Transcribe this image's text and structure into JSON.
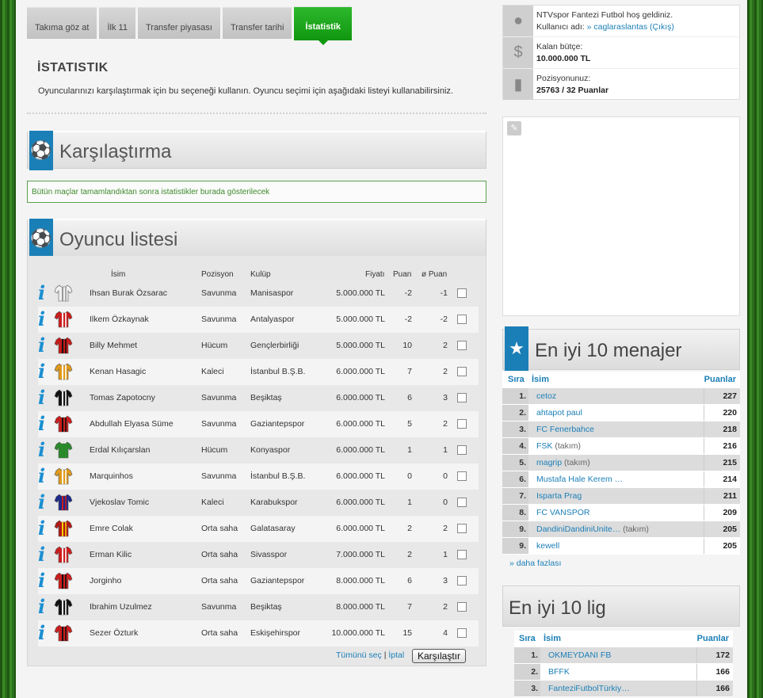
{
  "tabs": [
    "Takıma göz at",
    "İlk 11",
    "Transfer piyasası",
    "Transfer tarihi",
    "İstatistik"
  ],
  "section": {
    "title": "İSTATISTIK",
    "description": "Oyuncularınızı karşılaştırmak için bu seçeneği kullanın. Oyuncu seçimi için aşağıdaki listeyi kullanabilirsiniz."
  },
  "comparison": {
    "title": "Karşılaştırma",
    "notice": "Bütün maçlar tamamlandıktan sonra istatistikler burada gösterilecek"
  },
  "player_list": {
    "title": "Oyuncu listesi",
    "headers": {
      "name": "İsim",
      "position": "Pozisyon",
      "club": "Kulüp",
      "price": "Fiyatı",
      "points": "Puan",
      "avg": "ø Puan"
    },
    "players": [
      {
        "name": "Ihsan Burak Özsarac",
        "position": "Savunma",
        "club": "Manisaspor",
        "price": "5.000.000 TL",
        "points": "-2",
        "avg": "-1",
        "shirt": [
          "#f0f0f0",
          "#999999"
        ]
      },
      {
        "name": "Ilkem Özkaynak",
        "position": "Savunma",
        "club": "Antalyaspor",
        "price": "5.000.000 TL",
        "points": "-2",
        "avg": "-2",
        "shirt": [
          "#cc1c1c",
          "#ffffff"
        ]
      },
      {
        "name": "Billy Mehmet",
        "position": "Hücum",
        "club": "Gençlerbirliği",
        "price": "5.000.000 TL",
        "points": "10",
        "avg": "2",
        "shirt": [
          "#c81818",
          "#111111"
        ]
      },
      {
        "name": "Kenan Hasagic",
        "position": "Kaleci",
        "club": "İstanbul B.Ş.B.",
        "price": "6.000.000 TL",
        "points": "7",
        "avg": "2",
        "shirt": [
          "#e09a1a",
          "#ffffff"
        ]
      },
      {
        "name": "Tomas Zapotocny",
        "position": "Savunma",
        "club": "Beşiktaş",
        "price": "6.000.000 TL",
        "points": "6",
        "avg": "3",
        "shirt": [
          "#111111",
          "#ffffff"
        ]
      },
      {
        "name": "Abdullah Elyasa Süme",
        "position": "Savunma",
        "club": "Gaziantepspor",
        "price": "6.000.000 TL",
        "points": "5",
        "avg": "2",
        "shirt": [
          "#cc1c1c",
          "#111111"
        ]
      },
      {
        "name": "Erdal Kılıçarslan",
        "position": "Hücum",
        "club": "Konyaspor",
        "price": "6.000.000 TL",
        "points": "1",
        "avg": "1",
        "shirt": [
          "#2a8a2a",
          "#2a8a2a"
        ]
      },
      {
        "name": "Marquinhos",
        "position": "Savunma",
        "club": "İstanbul B.Ş.B.",
        "price": "6.000.000 TL",
        "points": "0",
        "avg": "0",
        "shirt": [
          "#e09a1a",
          "#ffffff"
        ]
      },
      {
        "name": "Vjekoslav Tomic",
        "position": "Kaleci",
        "club": "Karabukspor",
        "price": "6.000.000 TL",
        "points": "1",
        "avg": "0",
        "shirt": [
          "#1c2a8a",
          "#cc1c1c"
        ]
      },
      {
        "name": "Emre Colak",
        "position": "Orta saha",
        "club": "Galatasaray",
        "price": "6.000.000 TL",
        "points": "2",
        "avg": "2",
        "shirt": [
          "#b01818",
          "#f5d000"
        ]
      },
      {
        "name": "Erman Kilic",
        "position": "Orta saha",
        "club": "Sivasspor",
        "price": "7.000.000 TL",
        "points": "2",
        "avg": "1",
        "shirt": [
          "#cc1c1c",
          "#ffffff"
        ]
      },
      {
        "name": "Jorginho",
        "position": "Orta saha",
        "club": "Gaziantepspor",
        "price": "8.000.000 TL",
        "points": "6",
        "avg": "3",
        "shirt": [
          "#cc1c1c",
          "#111111"
        ]
      },
      {
        "name": "Ibrahim Uzulmez",
        "position": "Savunma",
        "club": "Beşiktaş",
        "price": "8.000.000 TL",
        "points": "7",
        "avg": "2",
        "shirt": [
          "#111111",
          "#ffffff"
        ]
      },
      {
        "name": "Sezer Özturk",
        "position": "Orta saha",
        "club": "Eskişehirspor",
        "price": "10.000.000 TL",
        "points": "15",
        "avg": "4",
        "shirt": [
          "#cc1c1c",
          "#111111"
        ]
      }
    ],
    "select_all": "Tümünü seç",
    "separator": "|",
    "cancel": "İptal",
    "compare_button": "Karşılaştır"
  },
  "user": {
    "welcome": "NTVspor Fantezi Futbol hoş geldiniz.",
    "username_label": "Kullanıcı adı:",
    "username": "» caglaraslantas",
    "logout": "(Çıkış)",
    "budget_label": "Kalan bütçe:",
    "budget": "10.000.000 TL",
    "position_label": "Pozisyonunuz:",
    "position": "25763 / 32 Puanlar"
  },
  "top_managers": {
    "title": "En iyi 10 menajer",
    "headers": {
      "rank": "Sıra",
      "name": "İsim",
      "points": "Puanlar"
    },
    "rows": [
      {
        "rank": "1.",
        "name": "cetoz",
        "suffix": "",
        "points": "227"
      },
      {
        "rank": "2.",
        "name": "ahtapot paul",
        "suffix": "",
        "points": "220"
      },
      {
        "rank": "3.",
        "name": "FC Fenerbahce",
        "suffix": "",
        "points": "218"
      },
      {
        "rank": "4.",
        "name": "FSK",
        "suffix": "(takım)",
        "points": "216"
      },
      {
        "rank": "5.",
        "name": "magrip",
        "suffix": "(takım)",
        "points": "215"
      },
      {
        "rank": "6.",
        "name": "Mustafa Hale Kerem …",
        "suffix": "",
        "points": "214"
      },
      {
        "rank": "7.",
        "name": "Isparta Prag",
        "suffix": "",
        "points": "211"
      },
      {
        "rank": "8.",
        "name": "FC VANSPOR",
        "suffix": "",
        "points": "209"
      },
      {
        "rank": "9.",
        "name": "DandiniDandiniUnite…",
        "suffix": "(takım)",
        "points": "205"
      },
      {
        "rank": "9.",
        "name": "kewell",
        "suffix": "",
        "points": "205"
      }
    ],
    "more": "» daha fazlası"
  },
  "top_leagues": {
    "title": "En iyi 10 lig",
    "headers": {
      "rank": "Sıra",
      "name": "İsim",
      "points": "Puanlar"
    },
    "rows": [
      {
        "rank": "1.",
        "name": "OKMEYDANI FB",
        "points": "172"
      },
      {
        "rank": "2.",
        "name": "BFFK",
        "points": "166"
      },
      {
        "rank": "3.",
        "name": "FanteziFutbolTürkiy…",
        "points": "166"
      }
    ]
  }
}
